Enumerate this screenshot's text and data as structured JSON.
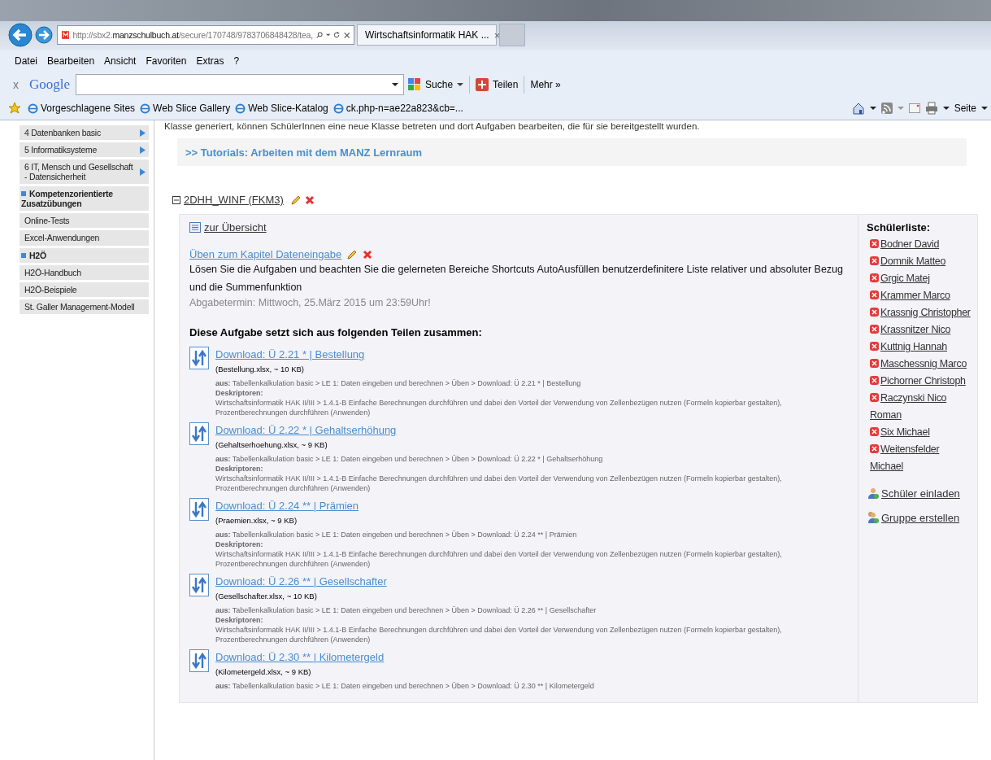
{
  "browser": {
    "address": {
      "prefix": "http://sbx2.",
      "domain": "manzschulbuch.at",
      "rest": "/secure/170748/9783706848428/tea,"
    },
    "tab": {
      "title": "Wirtschaftsinformatik HAK ...",
      "close": "×"
    },
    "menu": [
      "Datei",
      "Bearbeiten",
      "Ansicht",
      "Favoriten",
      "Extras",
      "?"
    ],
    "google_bar": {
      "close": "x",
      "logo": "Google",
      "search": "Suche",
      "share": "Teilen",
      "more": "Mehr »"
    },
    "favorites": [
      "Vorgeschlagene Sites",
      "Web Slice Gallery",
      "Web Slice-Katalog",
      "ck.php-n=ae22a823&cb=..."
    ],
    "page_menu": "Seite"
  },
  "sidebar": [
    {
      "kind": "item",
      "label": "4 Datenbanken basic",
      "submenu": true
    },
    {
      "kind": "item",
      "label": "5 Informatiksysteme",
      "submenu": true
    },
    {
      "kind": "item",
      "label": "6 IT, Mensch und Gesellschaft - Datensicherheit",
      "submenu": true
    },
    {
      "kind": "heading",
      "label": "Kompetenzorientierte Zusatzübungen",
      "submenu": false
    },
    {
      "kind": "item",
      "label": "Online-Tests",
      "submenu": false
    },
    {
      "kind": "item",
      "label": "Excel-Anwendungen",
      "submenu": false
    },
    {
      "kind": "heading",
      "label": "H2Ö",
      "submenu": false
    },
    {
      "kind": "item",
      "label": "H2Ö-Handbuch",
      "submenu": false
    },
    {
      "kind": "item",
      "label": "H2Ö-Beispiele",
      "submenu": false
    },
    {
      "kind": "item",
      "label": "St. Galler Management-Modell",
      "submenu": false
    }
  ],
  "intro_text": "Klasse generiert, können SchülerInnen eine neue Klasse betreten und dort Aufgaben bearbeiten, die für sie bereitgestellt wurden.",
  "tutorials_link": ">> Tutorials: Arbeiten mit dem MANZ Lernraum",
  "class": {
    "name": "2DHH_WINF (FKM3)",
    "expanded": true,
    "overview_link": "zur Übersicht",
    "task": {
      "title": "Üben zum Kapitel Dateneingabe",
      "description": "Lösen Sie die Aufgaben und beachten Sie die gelerneten Bereiche Shortcuts AutoAusfüllen benutzerdefinitere Liste relativer und absoluter Bezug und die Summenfunktion",
      "deadline": "Abgabetermin: Mittwoch, 25.März 2015 um 23:59Uhr!",
      "parts_heading": "Diese Aufgabe setzt sich aus folgenden Teilen zusammen:"
    },
    "downloads": [
      {
        "title": "Download: Ü 2.21 * | Bestellung",
        "file": "(Bestellung.xlsx, ~ 10 KB)",
        "source": "**aus:** Tabellenkalkulation basic > LE 1: Daten eingeben und berechnen > Üben > Download: Ü 2.21 * | Bestellung",
        "descriptor_label": "Deskriptoren:",
        "descriptor": "Wirtschaftsinformatik HAK II/III > 1.4.1-B Einfache Berechnungen durchführen und dabei den Vorteil der Verwendung von Zellenbezügen nutzen (Formeln kopierbar gestalten), Prozentberechnungen durchführen (Anwenden)"
      },
      {
        "title": "Download: Ü 2.22 * | Gehaltserhöhung",
        "file": "(Gehaltserhoehung.xlsx, ~ 9 KB)",
        "source": "**aus:** Tabellenkalkulation basic > LE 1: Daten eingeben und berechnen > Üben > Download: Ü 2.22 * | Gehaltserhöhung",
        "descriptor_label": "Deskriptoren:",
        "descriptor": "Wirtschaftsinformatik HAK II/III > 1.4.1-B Einfache Berechnungen durchführen und dabei den Vorteil der Verwendung von Zellenbezügen nutzen (Formeln kopierbar gestalten), Prozentberechnungen durchführen (Anwenden)"
      },
      {
        "title": "Download: Ü 2.24 ** | Prämien",
        "file": "(Praemien.xlsx, ~ 9 KB)",
        "source": "**aus:** Tabellenkalkulation basic > LE 1: Daten eingeben und berechnen > Üben > Download: Ü 2.24 ** | Prämien",
        "descriptor_label": "Deskriptoren:",
        "descriptor": "Wirtschaftsinformatik HAK II/III > 1.4.1-B Einfache Berechnungen durchführen und dabei den Vorteil der Verwendung von Zellenbezügen nutzen (Formeln kopierbar gestalten), Prozentberechnungen durchführen (Anwenden)"
      },
      {
        "title": "Download: Ü 2.26 ** | Gesellschafter",
        "file": "(Gesellschafter.xlsx, ~ 10 KB)",
        "source": "**aus:** Tabellenkalkulation basic > LE 1: Daten eingeben und berechnen > Üben > Download: Ü 2.26 ** | Gesellschafter",
        "descriptor_label": "Deskriptoren:",
        "descriptor": "Wirtschaftsinformatik HAK II/III > 1.4.1-B Einfache Berechnungen durchführen und dabei den Vorteil der Verwendung von Zellenbezügen nutzen (Formeln kopierbar gestalten), Prozentberechnungen durchführen (Anwenden)"
      },
      {
        "title": "Download: Ü 2.30 ** | Kilometergeld",
        "file": "(Kilometergeld.xlsx, ~ 9 KB)",
        "source": "**aus:** Tabellenkalkulation basic > LE 1: Daten eingeben und berechnen > Üben > Download: Ü 2.30 ** | Kilometergeld"
      }
    ],
    "students_heading": "Schülerliste:",
    "students": [
      "Bodner David",
      "Domnik Matteo",
      "Grgic Matej",
      "Krammer Marco",
      "Krassnig Christopher",
      "Krassnitzer Nico",
      "Kuttnig Hannah",
      "Maschessnig Marco",
      "Pichorner Christoph",
      "Raczynski Nico Roman",
      "Six Michael",
      "Weitensfelder Michael"
    ],
    "actions": [
      "Schüler einladen",
      "Gruppe erstellen"
    ]
  }
}
